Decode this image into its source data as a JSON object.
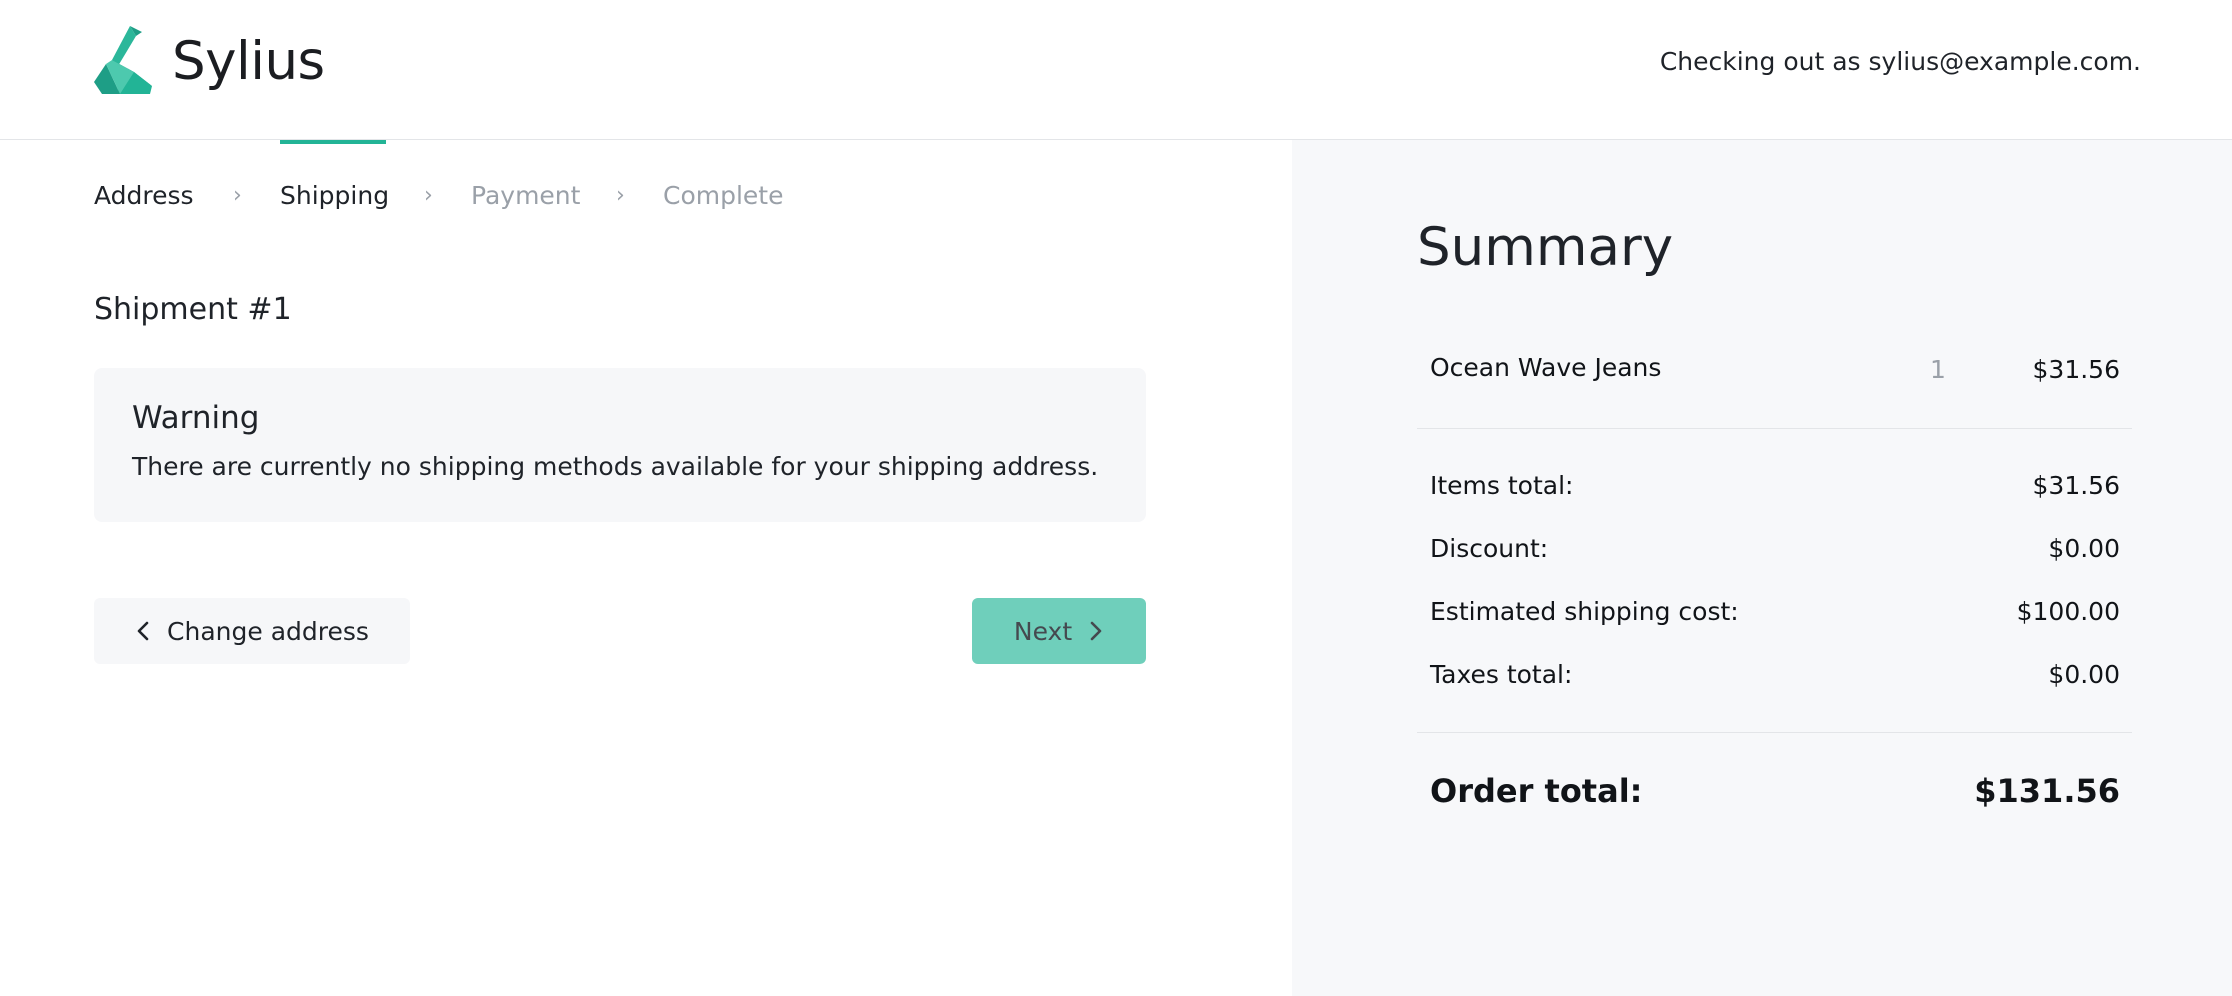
{
  "header": {
    "brand": "Sylius",
    "checking_out": "Checking out as sylius@example.com."
  },
  "steps": [
    {
      "label": "Address",
      "state": "done"
    },
    {
      "label": "Shipping",
      "state": "active"
    },
    {
      "label": "Payment",
      "state": "todo"
    },
    {
      "label": "Complete",
      "state": "todo"
    }
  ],
  "step_separator": "›",
  "shipment": {
    "title": "Shipment #1",
    "warning_title": "Warning",
    "warning_text": "There are currently no shipping methods available for your shipping address."
  },
  "actions": {
    "back_label": "Change address",
    "next_label": "Next"
  },
  "summary": {
    "title": "Summary",
    "items": [
      {
        "name": "Ocean Wave Jeans",
        "quantity": "1",
        "price": "$31.56"
      }
    ],
    "totals": [
      {
        "label": "Items total:",
        "value": "$31.56"
      },
      {
        "label": "Discount:",
        "value": "$0.00"
      },
      {
        "label": "Estimated shipping cost:",
        "value": "$100.00"
      },
      {
        "label": "Taxes total:",
        "value": "$0.00"
      }
    ],
    "order_total_label": "Order total:",
    "order_total_value": "$131.56"
  },
  "colors": {
    "accent": "#22b496",
    "next_button": "#6fcfbb",
    "summary_bg": "#f7f8fa",
    "warning_bg": "#f6f7f9",
    "muted_text": "#9aa0a8"
  },
  "icons": {
    "logo": "sylius-swan-logo",
    "back": "chevron-left-icon",
    "next": "chevron-right-icon"
  }
}
